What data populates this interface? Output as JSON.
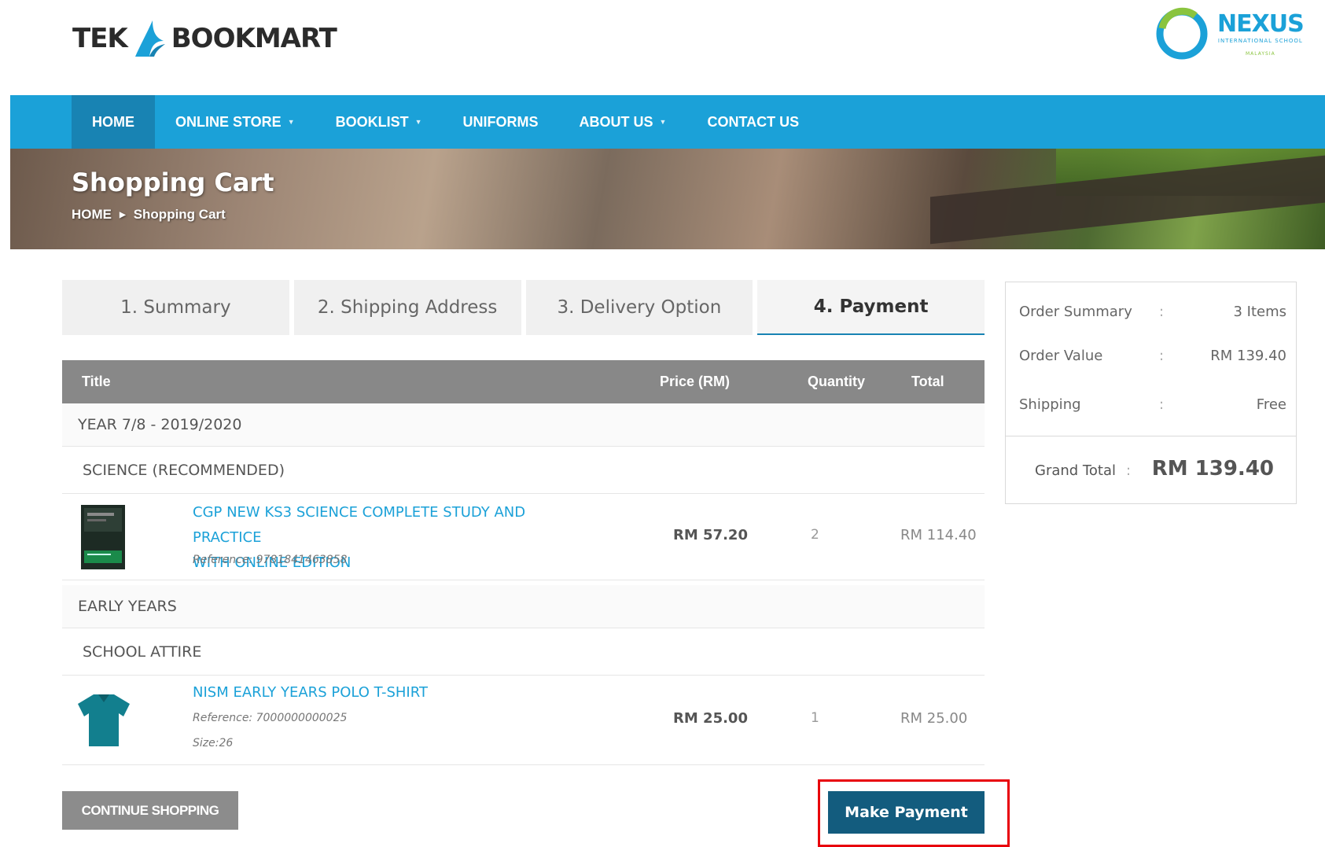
{
  "brand": {
    "left_word_1": "TEK",
    "left_word_2": "BOOKMART",
    "right_word": "NEXUS",
    "right_sub": "INTERNATIONAL SCHOOL",
    "right_country": "MALAYSIA"
  },
  "nav": {
    "items": [
      {
        "label": "HOME",
        "caret": false,
        "active": true
      },
      {
        "label": "ONLINE STORE",
        "caret": true,
        "active": false
      },
      {
        "label": "BOOKLIST",
        "caret": true,
        "active": false
      },
      {
        "label": "UNIFORMS",
        "caret": false,
        "active": false
      },
      {
        "label": "ABOUT US",
        "caret": true,
        "active": false
      },
      {
        "label": "CONTACT US",
        "caret": false,
        "active": false
      }
    ]
  },
  "banner": {
    "title": "Shopping Cart",
    "breadcrumb_home": "HOME",
    "breadcrumb_current": "Shopping Cart"
  },
  "steps": [
    {
      "label": "1. Summary",
      "active": false
    },
    {
      "label": "2. Shipping Address",
      "active": false
    },
    {
      "label": "3. Delivery Option",
      "active": false
    },
    {
      "label": "4. Payment",
      "active": true
    }
  ],
  "table": {
    "headers": {
      "title": "Title",
      "price": "Price (RM)",
      "quantity": "Quantity",
      "total": "Total"
    },
    "groups": [
      {
        "name": "YEAR 7/8 - 2019/2020",
        "category": "SCIENCE (RECOMMENDED)",
        "item": {
          "title_line1": "CGP NEW KS3 SCIENCE COMPLETE STUDY AND PRACTICE",
          "title_line2": "WITH ONLINE EDITION",
          "reference": "Reference: 9781841463858",
          "price": "RM 57.20",
          "quantity": "2",
          "total": "RM 114.40"
        }
      },
      {
        "name": "EARLY YEARS",
        "category": "SCHOOL ATTIRE",
        "item": {
          "title_line1": "NISM EARLY YEARS POLO T-SHIRT",
          "reference": "Reference: 7000000000025",
          "size": "Size:26",
          "price": "RM 25.00",
          "quantity": "1",
          "total": "RM 25.00"
        }
      }
    ]
  },
  "buttons": {
    "continue": "CONTINUE SHOPPING",
    "pay": "Make Payment"
  },
  "summary": {
    "order_summary_label": "Order Summary",
    "order_summary_value": "3 Items",
    "order_value_label": "Order Value",
    "order_value_value": "RM 139.40",
    "shipping_label": "Shipping",
    "shipping_value": "Free",
    "grand_total_label": "Grand Total",
    "grand_total_value": "RM 139.40",
    "colon": ":"
  },
  "colors": {
    "nav_bg": "#1ba1d8",
    "nav_active": "#1883b3",
    "pay_button": "#135c7e",
    "highlight": "#e8000b",
    "link": "#1ba1d8"
  }
}
